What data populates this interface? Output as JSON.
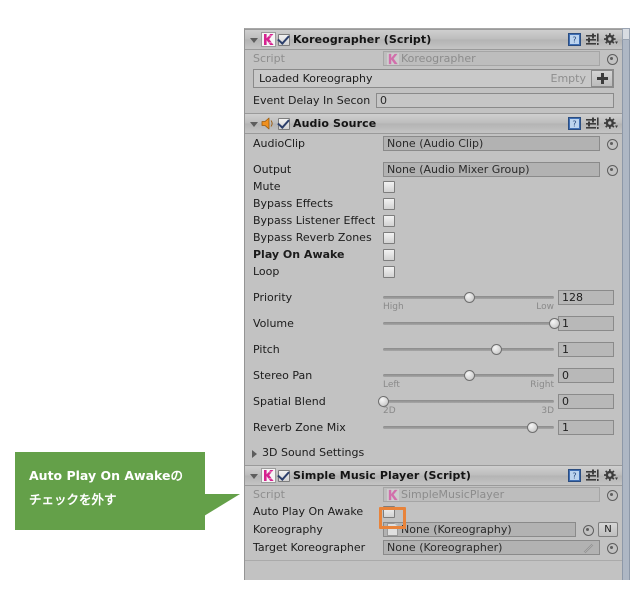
{
  "callout": {
    "line1": "Auto Play On Awakeの",
    "line2": "チェックを外す",
    "bg_color": "#64a049",
    "text_color": "#ffffff"
  },
  "highlight": {
    "color": "#e8833a",
    "target": "auto-play-on-awake-checkbox"
  },
  "inspector": {
    "components": [
      {
        "id": "koreographer",
        "title": "Koreographer (Script)",
        "icon": "koreographer-k-icon",
        "enabled": true,
        "expanded": true,
        "header_icons": [
          "help-icon",
          "preset-icon",
          "gear-icon"
        ],
        "rows": [
          {
            "type": "object",
            "label": "Script",
            "value": "Koreographer",
            "disabled": true,
            "picker": true,
            "icon": "koreographer-k-icon"
          },
          {
            "type": "listbox",
            "label": "Loaded Koreography",
            "status": "Empty",
            "add_label": "+"
          },
          {
            "type": "text",
            "label": "Event Delay In Secon",
            "value": "0"
          }
        ]
      },
      {
        "id": "audio-source",
        "title": "Audio Source",
        "icon": "speaker-icon",
        "enabled": true,
        "expanded": true,
        "header_icons": [
          "help-icon",
          "preset-icon",
          "gear-icon"
        ],
        "rows": [
          {
            "type": "object",
            "label": "AudioClip",
            "value": "None (Audio Clip)",
            "picker": true
          },
          {
            "type": "object",
            "label": "Output",
            "value": "None (Audio Mixer Group)",
            "picker": true
          },
          {
            "type": "checkbox",
            "label": "Mute",
            "checked": false
          },
          {
            "type": "checkbox",
            "label": "Bypass Effects",
            "checked": false
          },
          {
            "type": "checkbox",
            "label": "Bypass Listener Effect",
            "checked": false
          },
          {
            "type": "checkbox",
            "label": "Bypass Reverb Zones",
            "checked": false
          },
          {
            "type": "checkbox",
            "label": "Play On Awake",
            "checked": false,
            "bold": true
          },
          {
            "type": "checkbox",
            "label": "Loop",
            "checked": false
          },
          {
            "type": "slider",
            "label": "Priority",
            "value": "128",
            "pos": 50,
            "min_label": "High",
            "max_label": "Low"
          },
          {
            "type": "slider",
            "label": "Volume",
            "value": "1",
            "pos": 100,
            "min_label": "",
            "max_label": ""
          },
          {
            "type": "slider",
            "label": "Pitch",
            "value": "1",
            "pos": 66,
            "min_label": "",
            "max_label": ""
          },
          {
            "type": "slider",
            "label": "Stereo Pan",
            "value": "0",
            "pos": 50,
            "min_label": "Left",
            "max_label": "Right"
          },
          {
            "type": "slider",
            "label": "Spatial Blend",
            "value": "0",
            "pos": 0,
            "min_label": "2D",
            "max_label": "3D"
          },
          {
            "type": "slider",
            "label": "Reverb Zone Mix",
            "value": "1",
            "pos": 87,
            "min_label": "",
            "max_label": ""
          },
          {
            "type": "foldout",
            "label": "3D Sound Settings",
            "expanded": false
          }
        ]
      },
      {
        "id": "simple-music-player",
        "title": "Simple Music Player (Script)",
        "icon": "koreographer-k-icon",
        "enabled": true,
        "expanded": true,
        "header_icons": [
          "help-icon",
          "preset-icon",
          "gear-icon"
        ],
        "rows": [
          {
            "type": "object",
            "label": "Script",
            "value": "SimpleMusicPlayer",
            "disabled": true,
            "picker": true,
            "icon": "koreographer-k-icon"
          },
          {
            "type": "checkbox",
            "label": "Auto Play On Awake",
            "checked": false,
            "highlighted": true
          },
          {
            "type": "object",
            "label": "Koreography",
            "value": "None (Koreography)",
            "picker": true,
            "icon": "document-icon",
            "extra_button": "N"
          },
          {
            "type": "object",
            "label": "Target Koreographer",
            "value": "None (Koreographer)",
            "picker": true,
            "edit_icon": true
          }
        ]
      }
    ]
  }
}
